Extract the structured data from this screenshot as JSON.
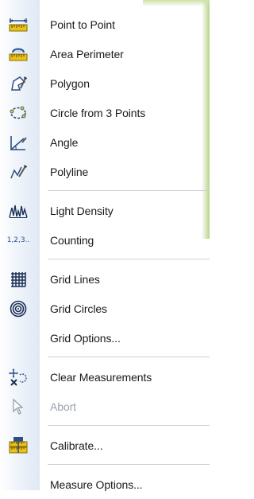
{
  "menu": {
    "items": [
      {
        "key": "point_to_point",
        "label": "Point to Point",
        "icon": "ruler-icon",
        "enabled": true
      },
      {
        "key": "area_perimeter",
        "label": "Area Perimeter",
        "icon": "area-ruler-icon",
        "enabled": true
      },
      {
        "key": "polygon",
        "label": "Polygon",
        "icon": "polygon-icon",
        "enabled": true
      },
      {
        "key": "circle_3",
        "label": "Circle from 3 Points",
        "icon": "circle-points-icon",
        "enabled": true
      },
      {
        "key": "angle",
        "label": "Angle",
        "icon": "angle-icon",
        "enabled": true
      },
      {
        "key": "polyline",
        "label": "Polyline",
        "icon": "polyline-icon",
        "enabled": true
      },
      {
        "key": "light_density",
        "label": "Light Density",
        "icon": "density-graph-icon",
        "enabled": true
      },
      {
        "key": "counting",
        "label": "Counting",
        "icon": "counting-icon",
        "icon_text": "1,2,3..",
        "enabled": true
      },
      {
        "key": "grid_lines",
        "label": "Grid Lines",
        "icon": "grid-lines-icon",
        "enabled": true
      },
      {
        "key": "grid_circles",
        "label": "Grid Circles",
        "icon": "grid-circles-icon",
        "enabled": true
      },
      {
        "key": "grid_options",
        "label": "Grid Options...",
        "icon": "",
        "enabled": true
      },
      {
        "key": "clear_measurements",
        "label": "Clear Measurements",
        "icon": "clear-measurements-icon",
        "enabled": true
      },
      {
        "key": "abort",
        "label": "Abort",
        "icon": "abort-cursor-icon",
        "enabled": false
      },
      {
        "key": "calibrate",
        "label": "Calibrate...",
        "icon": "calibrate-icon",
        "enabled": true
      },
      {
        "key": "measure_options",
        "label": "Measure Options...",
        "icon": "",
        "enabled": true
      }
    ]
  },
  "colors": {
    "text": "#1a1a1a",
    "disabled_text": "#9aa3ad",
    "icon_yellow": "#e8c21a",
    "icon_blue": "#2b4e86",
    "separator": "#c9ced6"
  }
}
